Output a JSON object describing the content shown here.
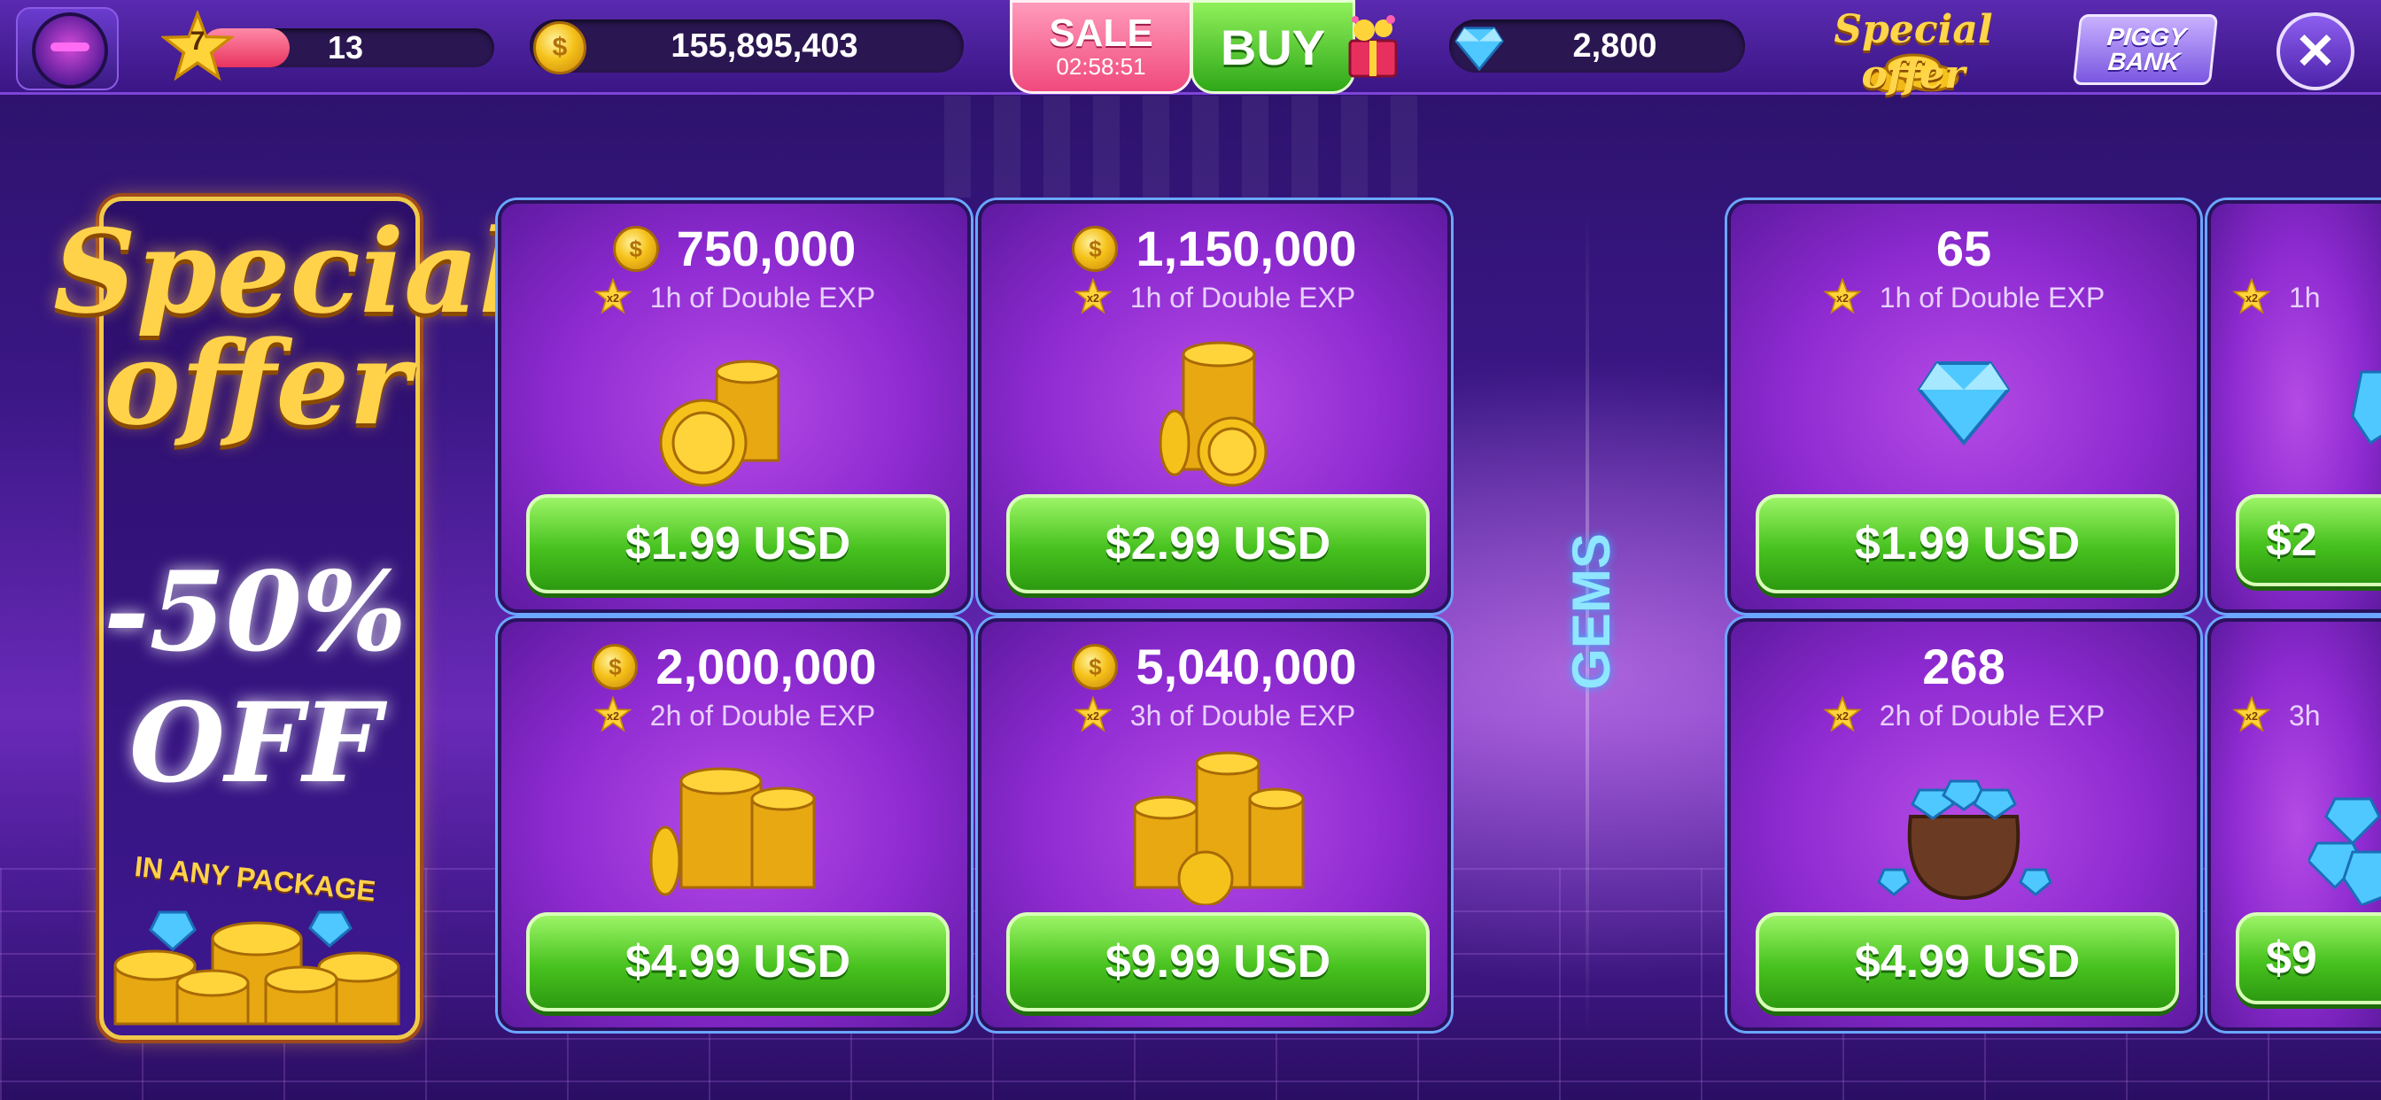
{
  "header": {
    "level": "7",
    "xp_value": "13",
    "xp_progress": 0.3,
    "coins": "155,895,403",
    "sale_label": "SALE",
    "sale_timer": "02:58:51",
    "buy_label": "BUY",
    "gems": "2,800",
    "special_offer_label": "Special offer",
    "piggy_line1": "PIGGY",
    "piggy_line2": "BANK",
    "close_label": "✕"
  },
  "offer_panel": {
    "title_line1": "Special",
    "title_line2": "offer",
    "discount_line1": "-50%",
    "discount_line2": "OFF",
    "subtitle": "IN ANY PACKAGE"
  },
  "gems_section_label": "GEMS",
  "coin_packages": [
    {
      "amount": "750,000",
      "exp": "1h of Double EXP",
      "price": "$1.99 USD"
    },
    {
      "amount": "1,150,000",
      "exp": "1h of Double EXP",
      "price": "$2.99 USD"
    },
    {
      "amount": "2,000,000",
      "exp": "2h of Double EXP",
      "price": "$4.99 USD"
    },
    {
      "amount": "5,040,000",
      "exp": "3h of Double EXP",
      "price": "$9.99 USD"
    }
  ],
  "gem_packages": [
    {
      "amount": "65",
      "exp": "1h of Double EXP",
      "price": "$1.99 USD"
    },
    {
      "amount": "268",
      "exp": "2h of Double EXP",
      "price": "$4.99 USD"
    }
  ],
  "partial_packages": [
    {
      "exp": "1h",
      "price": "$2"
    },
    {
      "exp": "3h",
      "price": "$9"
    }
  ],
  "colors": {
    "accent_green": "#47c21f",
    "card_purple": "#8d2ad0",
    "gold": "#ffd24a",
    "sale_pink": "#f0497d"
  }
}
